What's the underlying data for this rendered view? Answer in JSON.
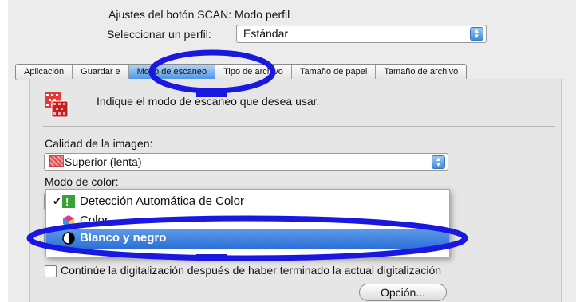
{
  "title": "Ajustes del botón SCAN: Modo perfil",
  "profile": {
    "label": "Seleccionar un perfil:",
    "value": "Estándar"
  },
  "tabs": [
    {
      "label": "Aplicación"
    },
    {
      "label": "Guardar e"
    },
    {
      "label": "Modo de escaneo",
      "active": true
    },
    {
      "label": "Tipo de archivo"
    },
    {
      "label": "Tamaño de papel"
    },
    {
      "label": "Tamaño de archivo"
    }
  ],
  "panel": {
    "instruction": "Indique el modo de escaneo que desea usar.",
    "image_quality": {
      "label": "Calidad de la imagen:",
      "value": "Superior (lenta)"
    },
    "color_mode": {
      "label": "Modo de color:",
      "menu": [
        {
          "label": "Detección Automática de Color",
          "checked": true,
          "icon": "auto-color-icon"
        },
        {
          "label": "Color",
          "icon": "color-icon"
        },
        {
          "label": "Blanco y negro",
          "highlighted": true,
          "icon": "bw-icon"
        }
      ]
    },
    "continue_scan": {
      "label": "Continúe la digitalización después  de haber terminado la actual digitalización",
      "checked": false
    },
    "option_button": "Opción..."
  },
  "annotation_color": "#1a17e0",
  "accent_color": "#3f8de0"
}
